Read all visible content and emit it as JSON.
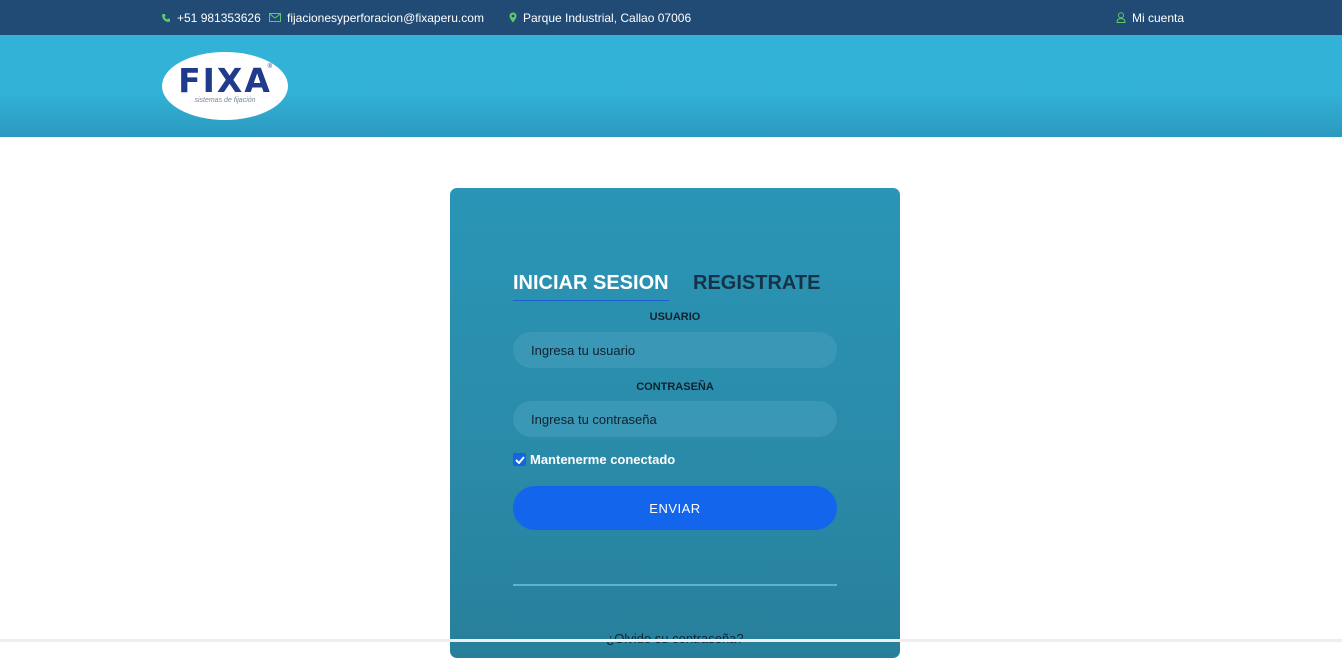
{
  "topbar": {
    "phone": "+51 981353626",
    "email": "fijacionesyperforacion@fixaperu.com",
    "address": "Parque Industrial, Callao 07006",
    "account": "Mi cuenta"
  },
  "logo": {
    "word": "FIXA",
    "tagline": "sistemas de fijación",
    "registered": "®"
  },
  "login": {
    "tabs": [
      "INICIAR SESION",
      "REGISTRATE"
    ],
    "active_tab": "INICIAR SESION",
    "username_label": "USUARIO",
    "username_placeholder": "Ingresa tu usuario",
    "username_value": "",
    "password_label": "CONTRASEÑA",
    "password_placeholder": "Ingresa tu contraseña",
    "password_value": "",
    "remember_label": "Mantenerme conectado",
    "remember_checked": true,
    "submit_label": "ENVIAR",
    "forgot_label": "¿Olvido su contraseña?"
  },
  "colors": {
    "topbar_bg": "#214b74",
    "header_bg": "#33b2d8",
    "card_bg": "#2a8aa8",
    "accent_blue": "#1365ec",
    "icon_green": "#5cc96a"
  },
  "icons": {
    "phone": "phone-icon",
    "email": "envelope-icon",
    "address": "map-pin-icon",
    "account": "user-icon",
    "checkbox": "check-icon"
  }
}
